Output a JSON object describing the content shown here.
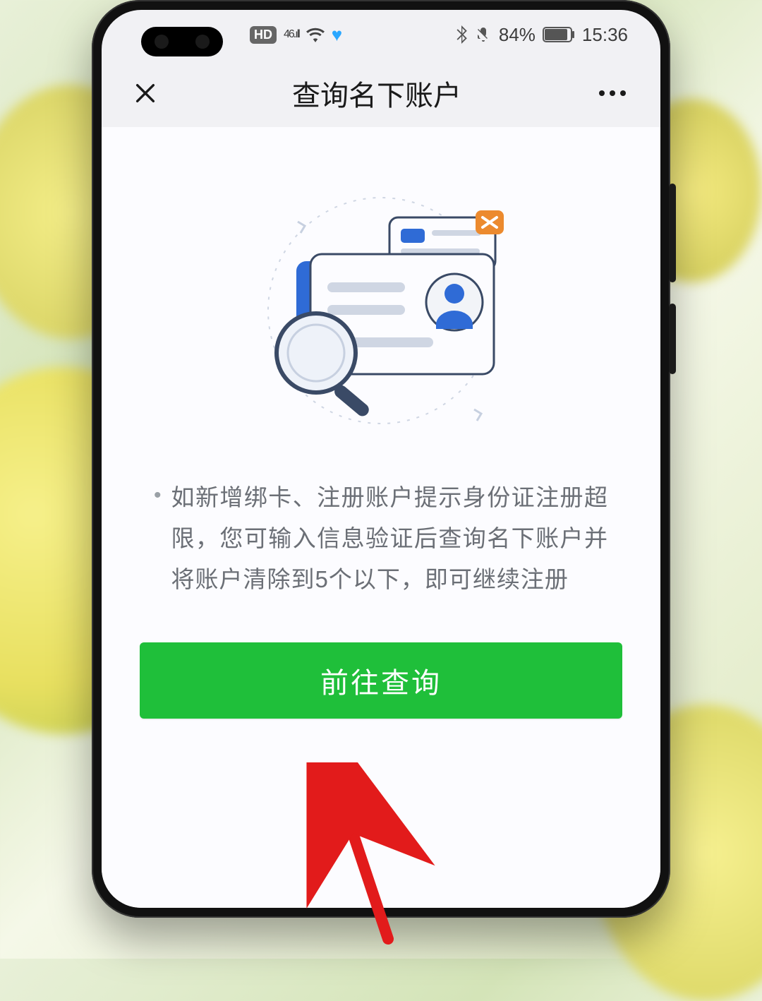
{
  "statusbar": {
    "hd_label": "HD",
    "net_label": "46",
    "battery_percent": "84%",
    "time": "15:36"
  },
  "navbar": {
    "title": "查询名下账户",
    "close_icon": "close-icon",
    "more_icon": "more-icon"
  },
  "content": {
    "bullet_text": "如新增绑卡、注册账户提示身份证注册超限，您可输入信息验证后查询名下账户并将账户清除到5个以下，即可继续注册",
    "primary_button_label": "前往查询"
  },
  "colors": {
    "primary_green": "#1fbf3a",
    "text_muted": "#6b6f76",
    "accent_blue": "#2f6bd6",
    "accent_orange": "#ec8a2e"
  },
  "illustration": {
    "semantic": "id-card-search-illustration"
  },
  "annotation": {
    "semantic": "red-arrow-pointing-to-button"
  }
}
